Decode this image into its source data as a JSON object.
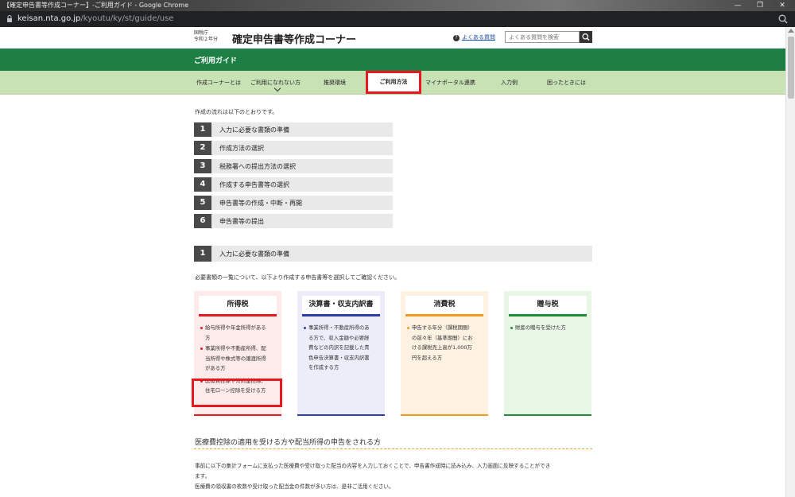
{
  "browser": {
    "window_title": "【確定申告書等作成コーナー】-ご利用ガイド - Google Chrome",
    "url_host": "keisan.nta.go.jp",
    "url_path": "/kyoutu/ky/st/guide/use",
    "minimize_glyph": "—",
    "maximize_glyph": "❐",
    "close_glyph": "✕"
  },
  "header": {
    "agency_line1": "国税庁",
    "agency_line2": "令和２年分",
    "site_title": "確定申告書等作成コーナー",
    "faq_icon": "?",
    "faq_link": "よくある質問",
    "faq_search_placeholder": "よくある質問を検索"
  },
  "guide_bar": {
    "label": "ご利用ガイド"
  },
  "nav": {
    "items": [
      {
        "label": "作成コーナーとは"
      },
      {
        "label": "ご利用になれない方"
      },
      {
        "label": "推奨環境"
      },
      {
        "label": "ご利用方法"
      },
      {
        "label": "マイナポータル連携"
      },
      {
        "label": "入力例"
      },
      {
        "label": "困ったときには"
      }
    ],
    "active_index": 3
  },
  "content": {
    "intro": "作成の流れは以下のとおりです。",
    "steps": [
      {
        "num": "1",
        "label": "入力に必要な書類の準備"
      },
      {
        "num": "2",
        "label": "作成方法の選択"
      },
      {
        "num": "3",
        "label": "税務署への提出方法の選択"
      },
      {
        "num": "4",
        "label": "作成する申告書等の選択"
      },
      {
        "num": "5",
        "label": "申告書等の作成・中断・再開"
      },
      {
        "num": "6",
        "label": "申告書等の提出"
      }
    ],
    "section": {
      "num": "1",
      "title": "入力に必要な書類の準備",
      "description": "必要書類の一覧について、以下より作成する申告書等を選択してご確認ください。"
    },
    "cards": [
      {
        "title": "所得税",
        "accent": "#e8191e",
        "bg": "#fdeaea",
        "items": [
          [
            "給与所得や年金所得がある",
            "方"
          ],
          [
            "事業所得や不動産所得、配",
            "当所得や株式等の譲渡所得",
            "がある方"
          ],
          [
            "医療費控除や寄附金控除、",
            "住宅ローン控除を受ける方"
          ]
        ]
      },
      {
        "title": "決算書・収支内訳書",
        "accent": "#2d3ea8",
        "bg": "#ecedf9",
        "items": [
          [
            "事業所得・不動産所得のあ",
            "る方で、収入金額や必要経",
            "費などの内訳を記載した青",
            "色申告決算書・収支内訳書",
            "を作成する方"
          ]
        ]
      },
      {
        "title": "消費税",
        "accent": "#f29b1d",
        "bg": "#fdf1e2",
        "items": [
          [
            "申告する年分（課税期間）",
            "の前々年（基準期間）にお",
            "ける課税売上高が1,000万",
            "円を超える方"
          ]
        ]
      },
      {
        "title": "贈与税",
        "accent": "#1e8a3a",
        "bg": "#e8f6e6",
        "items": [
          [
            "財産の贈与を受けた方"
          ]
        ]
      }
    ],
    "sub_title": "医療費控除の適用を受ける方や配当所得の申告をされる方",
    "paragraphs": [
      "事前に以下の集計フォームに支払った医療費や受け取った配当の内容を入力しておくことで、申告書作成時に読み込み、入力画面に反映することができ",
      "ます。",
      "医療費の領収書の枚数や受け取った配当金の件数が多い方は、是非ご活用ください。"
    ]
  }
}
